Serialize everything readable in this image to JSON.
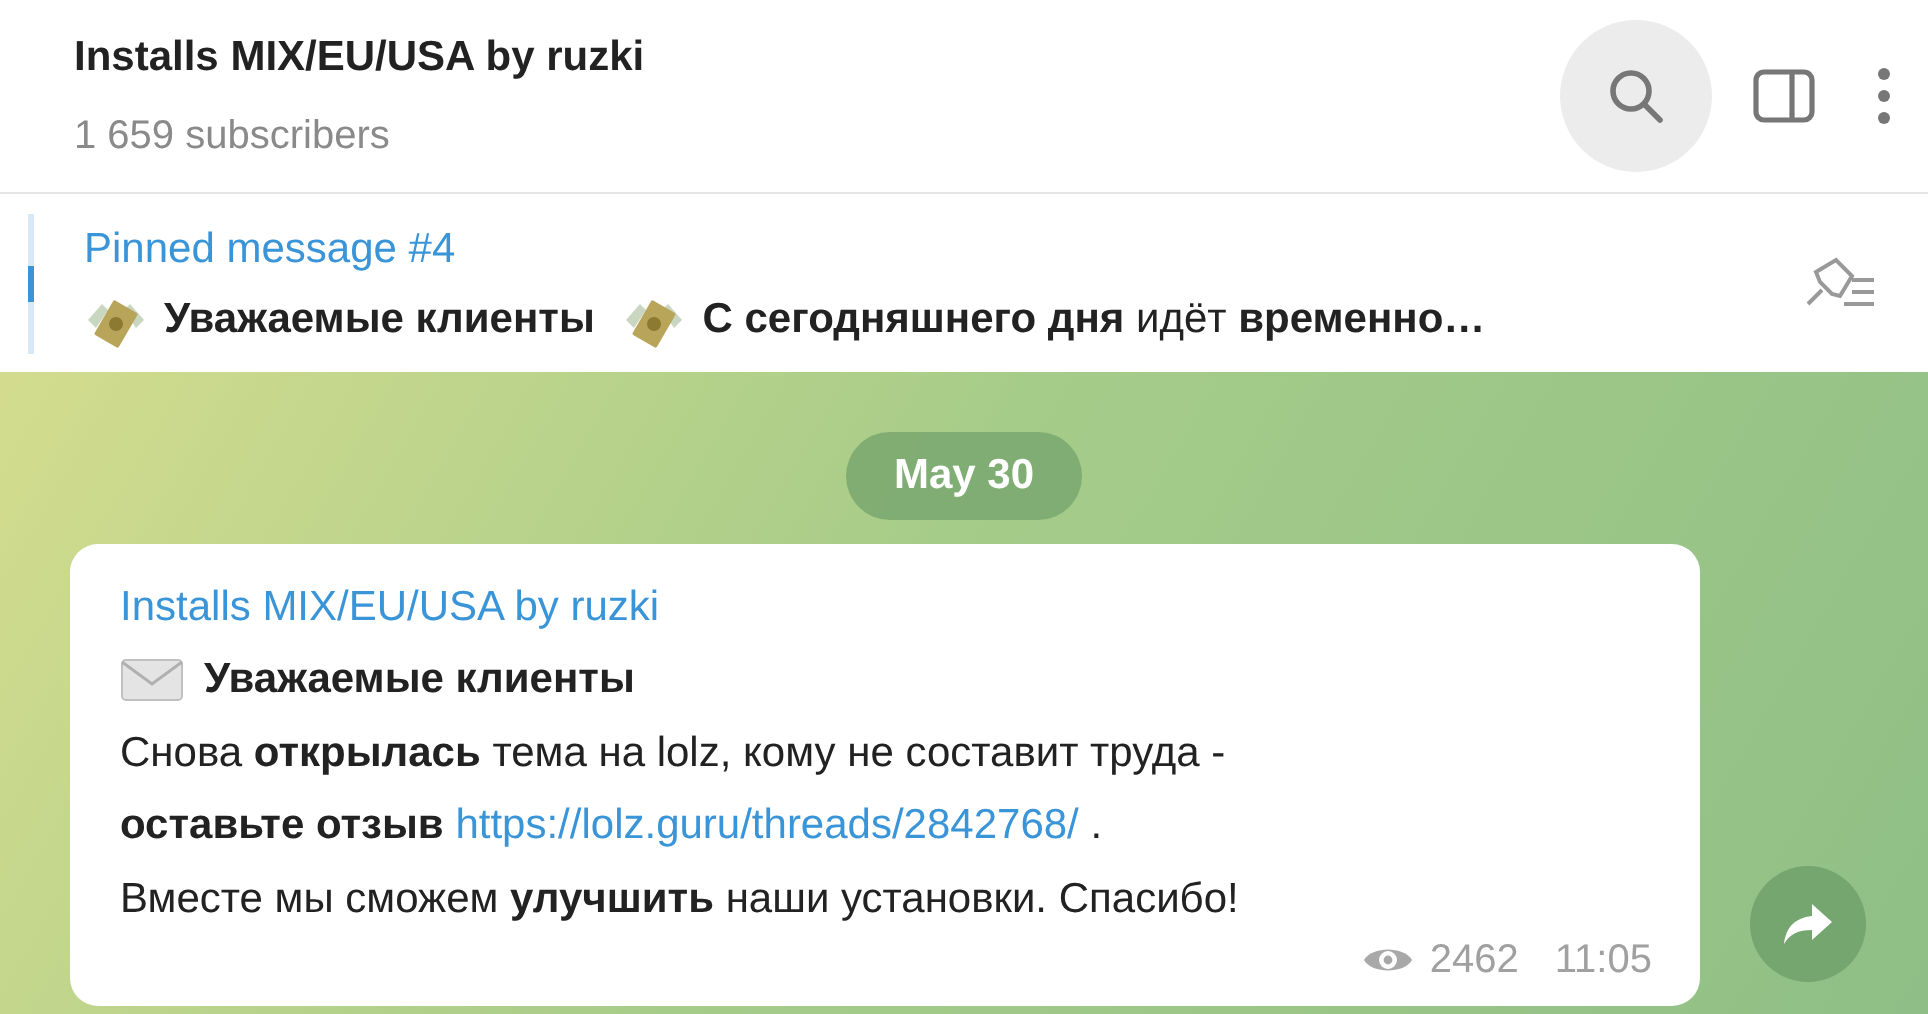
{
  "header": {
    "title": "Installs MIX/EU/USA by ruzki",
    "subtitle": "1 659 subscribers"
  },
  "pinned": {
    "label": "Pinned message #4",
    "parts": [
      {
        "kind": "money"
      },
      {
        "kind": "text",
        "text": "**Уважаемые клиенты** "
      },
      {
        "kind": "money"
      },
      {
        "kind": "text",
        "text": "**С сегодняшнего дня** идёт **временно…**"
      }
    ]
  },
  "date": "May 30",
  "message": {
    "author": "Installs MIX/EU/USA by ruzki",
    "lines": [
      {
        "kind": "envelope",
        "text": "**Уважаемые клиенты**"
      },
      {
        "kind": "text",
        "text": "Снова **открылась** тема на lolz, кому не составит труда -"
      },
      {
        "kind": "link",
        "text": "**оставьте отзыв** ",
        "link": "https://lolz.guru/threads/2842768/",
        "after": " ."
      },
      {
        "kind": "text",
        "text": "Вместе мы сможем **улучшить** наши установки. Спасибо!"
      }
    ],
    "views": "2462",
    "time": "11:05"
  }
}
